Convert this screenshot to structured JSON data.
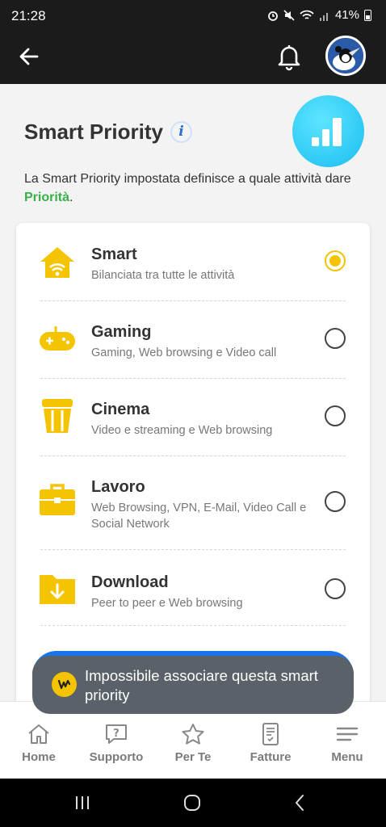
{
  "status_bar": {
    "time": "21:28",
    "battery": "41%"
  },
  "app_bar": {
    "back_icon": "arrow-left-icon",
    "bell_icon": "bell-icon",
    "avatar_icon": "profile-avatar"
  },
  "page": {
    "title": "Smart Priority",
    "info_icon": "i",
    "description_prefix": "La Smart Priority impostata definisce a quale attività dare ",
    "description_highlight": "Priorità",
    "description_suffix": "."
  },
  "options": [
    {
      "title": "Smart",
      "subtitle": "Bilanciata tra tutte le attività",
      "icon": "home-wifi-icon",
      "selected": true
    },
    {
      "title": "Gaming",
      "subtitle": "Gaming, Web browsing e Video call",
      "icon": "gamepad-icon",
      "selected": false
    },
    {
      "title": "Cinema",
      "subtitle": "Video e streaming e Web browsing",
      "icon": "popcorn-icon",
      "selected": false
    },
    {
      "title": "Lavoro",
      "subtitle": "Web Browsing, VPN, E-Mail, Video Call e Social Network",
      "icon": "briefcase-icon",
      "selected": false
    },
    {
      "title": "Download",
      "subtitle": "Peer to peer e Web browsing",
      "icon": "download-folder-icon",
      "selected": false
    }
  ],
  "toast": {
    "text": "Impossibile associare questa smart priority"
  },
  "bottom_nav": [
    {
      "label": "Home",
      "icon": "home-icon"
    },
    {
      "label": "Supporto",
      "icon": "support-icon"
    },
    {
      "label": "Per Te",
      "icon": "star-icon"
    },
    {
      "label": "Fatture",
      "icon": "bill-icon"
    },
    {
      "label": "Menu",
      "icon": "menu-icon"
    }
  ],
  "colors": {
    "accent_yellow": "#f5c400",
    "highlight_green": "#38b04a",
    "primary_blue": "#1a73e8",
    "dark_bar": "#1b1b1b"
  }
}
